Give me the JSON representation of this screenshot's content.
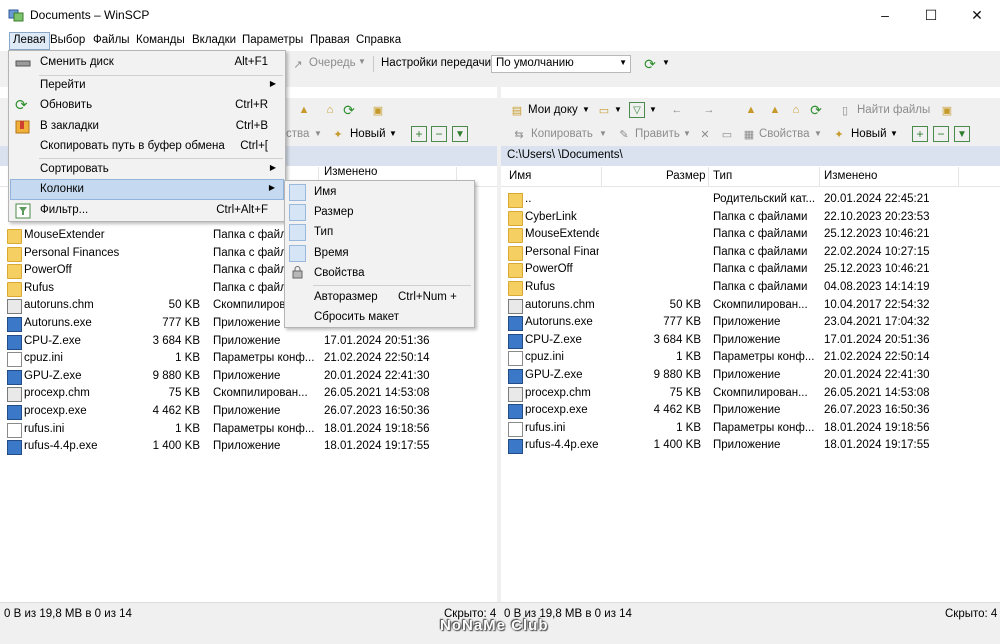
{
  "window": {
    "title": "Documents – WinSCP",
    "controls": [
      "–",
      "☐",
      "✕"
    ]
  },
  "menubar": [
    "Левая",
    "Выбор",
    "Файлы",
    "Команды",
    "Вкладки",
    "Параметры",
    "Правая",
    "Справка"
  ],
  "toolbar_top": {
    "queue_label": "Очередь",
    "transfer_settings_label": "Настройки передачи",
    "transfer_settings_value": "По умолчанию"
  },
  "left_toolbar": {
    "properties_label": "ства",
    "new_label": "Новый"
  },
  "right_toolbar": {
    "location_label": "Мои доку",
    "find_files_label": "Найти файлы",
    "copy_label": "Копировать",
    "edit_label": "Править",
    "properties_label": "Свойства",
    "new_label": "Новый"
  },
  "left_header_partial": "Изменено",
  "right_panel": {
    "path": "C:\\Users\\        \\Documents\\",
    "columns": [
      "Имя",
      "Размер",
      "Тип",
      "Изменено"
    ]
  },
  "left_rows": [
    {
      "name": "MouseExtender",
      "size": "",
      "type": "Папка с файл",
      "date": "",
      "icon": "folder"
    },
    {
      "name": "Personal Finances",
      "size": "",
      "type": "Папка с файл",
      "date": "",
      "icon": "folder"
    },
    {
      "name": "PowerOff",
      "size": "",
      "type": "Папка с файл",
      "date": "",
      "icon": "folder"
    },
    {
      "name": "Rufus",
      "size": "",
      "type": "Папка с файл",
      "date": "",
      "icon": "folder"
    },
    {
      "name": "autoruns.chm",
      "size": "50 KB",
      "type": "Скомпилиров",
      "date": "",
      "icon": "chm"
    },
    {
      "name": "Autoruns.exe",
      "size": "777 KB",
      "type": "Приложение",
      "date": "",
      "icon": "exe"
    },
    {
      "name": "CPU-Z.exe",
      "size": "3 684 KB",
      "type": "Приложение",
      "date": "17.01.2024 20:51:36",
      "icon": "exe"
    },
    {
      "name": "cpuz.ini",
      "size": "1 KB",
      "type": "Параметры конф...",
      "date": "21.02.2024 22:50:14",
      "icon": "file"
    },
    {
      "name": "GPU-Z.exe",
      "size": "9 880 KB",
      "type": "Приложение",
      "date": "20.01.2024 22:41:30",
      "icon": "exe"
    },
    {
      "name": "procexp.chm",
      "size": "75 KB",
      "type": "Скомпилирован...",
      "date": "26.05.2021 14:53:08",
      "icon": "chm"
    },
    {
      "name": "procexp.exe",
      "size": "4 462 KB",
      "type": "Приложение",
      "date": "26.07.2023 16:50:36",
      "icon": "exe"
    },
    {
      "name": "rufus.ini",
      "size": "1 KB",
      "type": "Параметры конф...",
      "date": "18.01.2024 19:18:56",
      "icon": "file"
    },
    {
      "name": "rufus-4.4p.exe",
      "size": "1 400 KB",
      "type": "Приложение",
      "date": "18.01.2024 19:17:55",
      "icon": "exe"
    }
  ],
  "right_rows": [
    {
      "name": "..",
      "size": "",
      "type": "Родительский кат...",
      "date": "20.01.2024 22:45:21",
      "icon": "up"
    },
    {
      "name": "CyberLink",
      "size": "",
      "type": "Папка с файлами",
      "date": "22.10.2023 20:23:53",
      "icon": "folder"
    },
    {
      "name": "MouseExtender",
      "size": "",
      "type": "Папка с файлами",
      "date": "25.12.2023 10:46:21",
      "icon": "folder"
    },
    {
      "name": "Personal Finances",
      "size": "",
      "type": "Папка с файлами",
      "date": "22.02.2024 10:27:15",
      "icon": "folder"
    },
    {
      "name": "PowerOff",
      "size": "",
      "type": "Папка с файлами",
      "date": "25.12.2023 10:46:21",
      "icon": "folder"
    },
    {
      "name": "Rufus",
      "size": "",
      "type": "Папка с файлами",
      "date": "04.08.2023 14:14:19",
      "icon": "folder"
    },
    {
      "name": "autoruns.chm",
      "size": "50 KB",
      "type": "Скомпилирован...",
      "date": "10.04.2017 22:54:32",
      "icon": "chm"
    },
    {
      "name": "Autoruns.exe",
      "size": "777 KB",
      "type": "Приложение",
      "date": "23.04.2021 17:04:32",
      "icon": "exe"
    },
    {
      "name": "CPU-Z.exe",
      "size": "3 684 KB",
      "type": "Приложение",
      "date": "17.01.2024 20:51:36",
      "icon": "exe"
    },
    {
      "name": "cpuz.ini",
      "size": "1 KB",
      "type": "Параметры конф...",
      "date": "21.02.2024 22:50:14",
      "icon": "file"
    },
    {
      "name": "GPU-Z.exe",
      "size": "9 880 KB",
      "type": "Приложение",
      "date": "20.01.2024 22:41:30",
      "icon": "exe"
    },
    {
      "name": "procexp.chm",
      "size": "75 KB",
      "type": "Скомпилирован...",
      "date": "26.05.2021 14:53:08",
      "icon": "chm"
    },
    {
      "name": "procexp.exe",
      "size": "4 462 KB",
      "type": "Приложение",
      "date": "26.07.2023 16:50:36",
      "icon": "exe"
    },
    {
      "name": "rufus.ini",
      "size": "1 KB",
      "type": "Параметры конф...",
      "date": "18.01.2024 19:18:56",
      "icon": "file"
    },
    {
      "name": "rufus-4.4p.exe",
      "size": "1 400 KB",
      "type": "Приложение",
      "date": "18.01.2024 19:17:55",
      "icon": "exe"
    }
  ],
  "dropdown": {
    "change_drive": {
      "label": "Сменить диск",
      "shortcut": "Alt+F1"
    },
    "goto": {
      "label": "Перейти"
    },
    "refresh": {
      "label": "Обновить",
      "shortcut": "Ctrl+R"
    },
    "bookmarks": {
      "label": "В закладки",
      "shortcut": "Ctrl+B"
    },
    "copy_path": {
      "label": "Скопировать путь в буфер обмена",
      "shortcut": "Ctrl+["
    },
    "sort": {
      "label": "Сортировать"
    },
    "columns": {
      "label": "Колонки"
    },
    "filter": {
      "label": "Фильтр...",
      "shortcut": "Ctrl+Alt+F"
    }
  },
  "submenu": {
    "name": "Имя",
    "size": "Размер",
    "type": "Тип",
    "time": "Время",
    "properties": "Свойства",
    "autosize": {
      "label": "Авторазмер",
      "shortcut": "Ctrl+Num +"
    },
    "reset": "Сбросить макет"
  },
  "status": {
    "left_info": "0 B из 19,8 MB в 0 из 14",
    "left_hidden": "Скрыто: 4",
    "right_info": "0 B из 19,8 MB в 0 из 14",
    "right_hidden": "Скрыто: 4"
  },
  "watermark": "NoNaMe Club",
  "colors": {
    "path_bar": "#d9e2ee",
    "menu_highlight": "#c5daf0",
    "folder": "#f5cf61"
  }
}
